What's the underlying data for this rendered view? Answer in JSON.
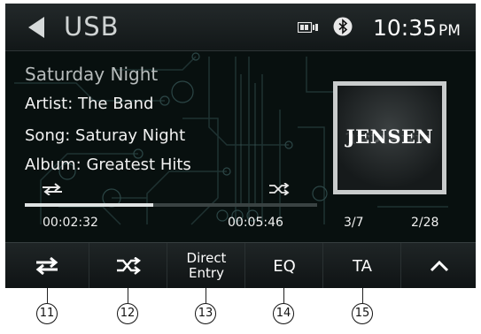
{
  "header": {
    "source_title": "USB",
    "clock_time": "10:35",
    "clock_ampm": "PM"
  },
  "track": {
    "title": "Saturday Night",
    "artist_line": "Artist: The Band",
    "song_line": "Song: Saturay Night",
    "album_line": "Album: Greatest Hits",
    "album_art_brand": "JENSEN",
    "elapsed": "00:02:32",
    "total": "00:05:46",
    "progress_fraction": 0.44,
    "track_count": "3/7",
    "folder_count": "2/28"
  },
  "buttons": {
    "direct_entry_line1": "Direct",
    "direct_entry_line2": "Entry",
    "eq": "EQ",
    "ta": "TA"
  },
  "callouts": [
    "11",
    "12",
    "13",
    "14",
    "15"
  ]
}
